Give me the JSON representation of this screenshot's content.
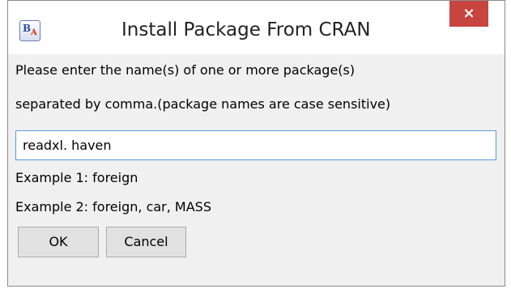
{
  "window": {
    "title": "Install Package From CRAN",
    "app_icon": "BA-app-icon",
    "close_label": "×"
  },
  "body": {
    "instruction_line1": "Please enter the name(s) of one or more package(s)",
    "instruction_line2": "separated by comma.(package names are case sensitive)",
    "package_input_value": "readxl. haven",
    "example1": "Example 1: foreign",
    "example2": "Example 2: foreign, car, MASS"
  },
  "buttons": {
    "ok_label": "OK",
    "cancel_label": "Cancel"
  },
  "colors": {
    "close_button_bg": "#c7443f",
    "input_border": "#5b9bd5",
    "window_bg": "#f0f0f0"
  }
}
